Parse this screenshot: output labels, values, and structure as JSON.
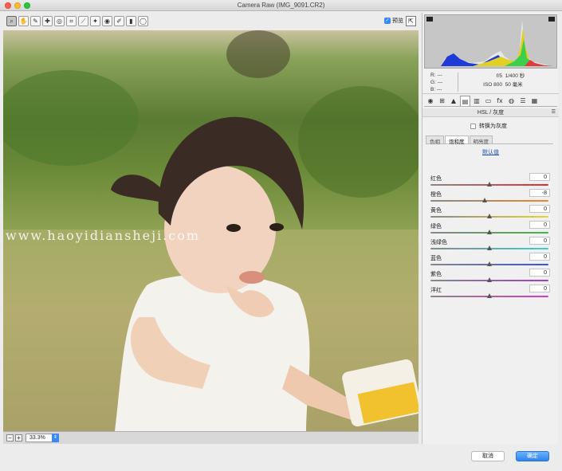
{
  "window": {
    "title": "Camera Raw (IMG_9091.CR2)"
  },
  "toolbar": {
    "tools": [
      {
        "name": "zoom-tool",
        "glyph": "⌕"
      },
      {
        "name": "hand-tool",
        "glyph": "✋"
      },
      {
        "name": "white-balance-tool",
        "glyph": "✎"
      },
      {
        "name": "color-sampler-tool",
        "glyph": "✚"
      },
      {
        "name": "target-adjust-tool",
        "glyph": "◎"
      },
      {
        "name": "crop-tool",
        "glyph": "⌗"
      },
      {
        "name": "straighten-tool",
        "glyph": "⟋"
      },
      {
        "name": "spot-removal-tool",
        "glyph": "✦"
      },
      {
        "name": "red-eye-tool",
        "glyph": "◉"
      },
      {
        "name": "adjustment-brush-tool",
        "glyph": "✐"
      },
      {
        "name": "graduated-filter-tool",
        "glyph": "▮"
      },
      {
        "name": "radial-filter-tool",
        "glyph": "◯"
      }
    ],
    "preview_label": "预览",
    "preview_checked": true
  },
  "image": {
    "watermark": "www.haoyidiansheji.com"
  },
  "zoom": {
    "value": "33.3%"
  },
  "info": {
    "r_label": "R:",
    "r_value": "---",
    "g_label": "G:",
    "g_value": "---",
    "b_label": "B:",
    "b_value": "---",
    "aperture": "f/5",
    "shutter": "1/400 秒",
    "iso": "ISO 800",
    "focal": "50 毫米"
  },
  "panel": {
    "section_title": "HSL / 灰度",
    "grayscale_label": "转换为灰度",
    "subtabs": [
      "色相",
      "饱和度",
      "明亮度"
    ],
    "active_subtab": 1,
    "default_link": "默认值",
    "sliders": [
      {
        "label": "红色",
        "value": "0",
        "pos": 0.5,
        "gradient": "linear-gradient(90deg,#888,#e03030)"
      },
      {
        "label": "橙色",
        "value": "-8",
        "pos": 0.46,
        "gradient": "linear-gradient(90deg,#888,#e98a2c)"
      },
      {
        "label": "黄色",
        "value": "0",
        "pos": 0.5,
        "gradient": "linear-gradient(90deg,#888,#e6d530)"
      },
      {
        "label": "绿色",
        "value": "0",
        "pos": 0.5,
        "gradient": "linear-gradient(90deg,#888,#44b844)"
      },
      {
        "label": "浅绿色",
        "value": "0",
        "pos": 0.5,
        "gradient": "linear-gradient(90deg,#888,#3ccfcf)"
      },
      {
        "label": "蓝色",
        "value": "0",
        "pos": 0.5,
        "gradient": "linear-gradient(90deg,#888,#3a52d8)"
      },
      {
        "label": "紫色",
        "value": "0",
        "pos": 0.5,
        "gradient": "linear-gradient(90deg,#888,#9a40d8)"
      },
      {
        "label": "洋红",
        "value": "0",
        "pos": 0.5,
        "gradient": "linear-gradient(90deg,#888,#d83ab8)"
      }
    ]
  },
  "footer": {
    "cancel_label": "取消",
    "ok_label": "确定"
  },
  "colors": {
    "accent": "#3a87f5"
  }
}
